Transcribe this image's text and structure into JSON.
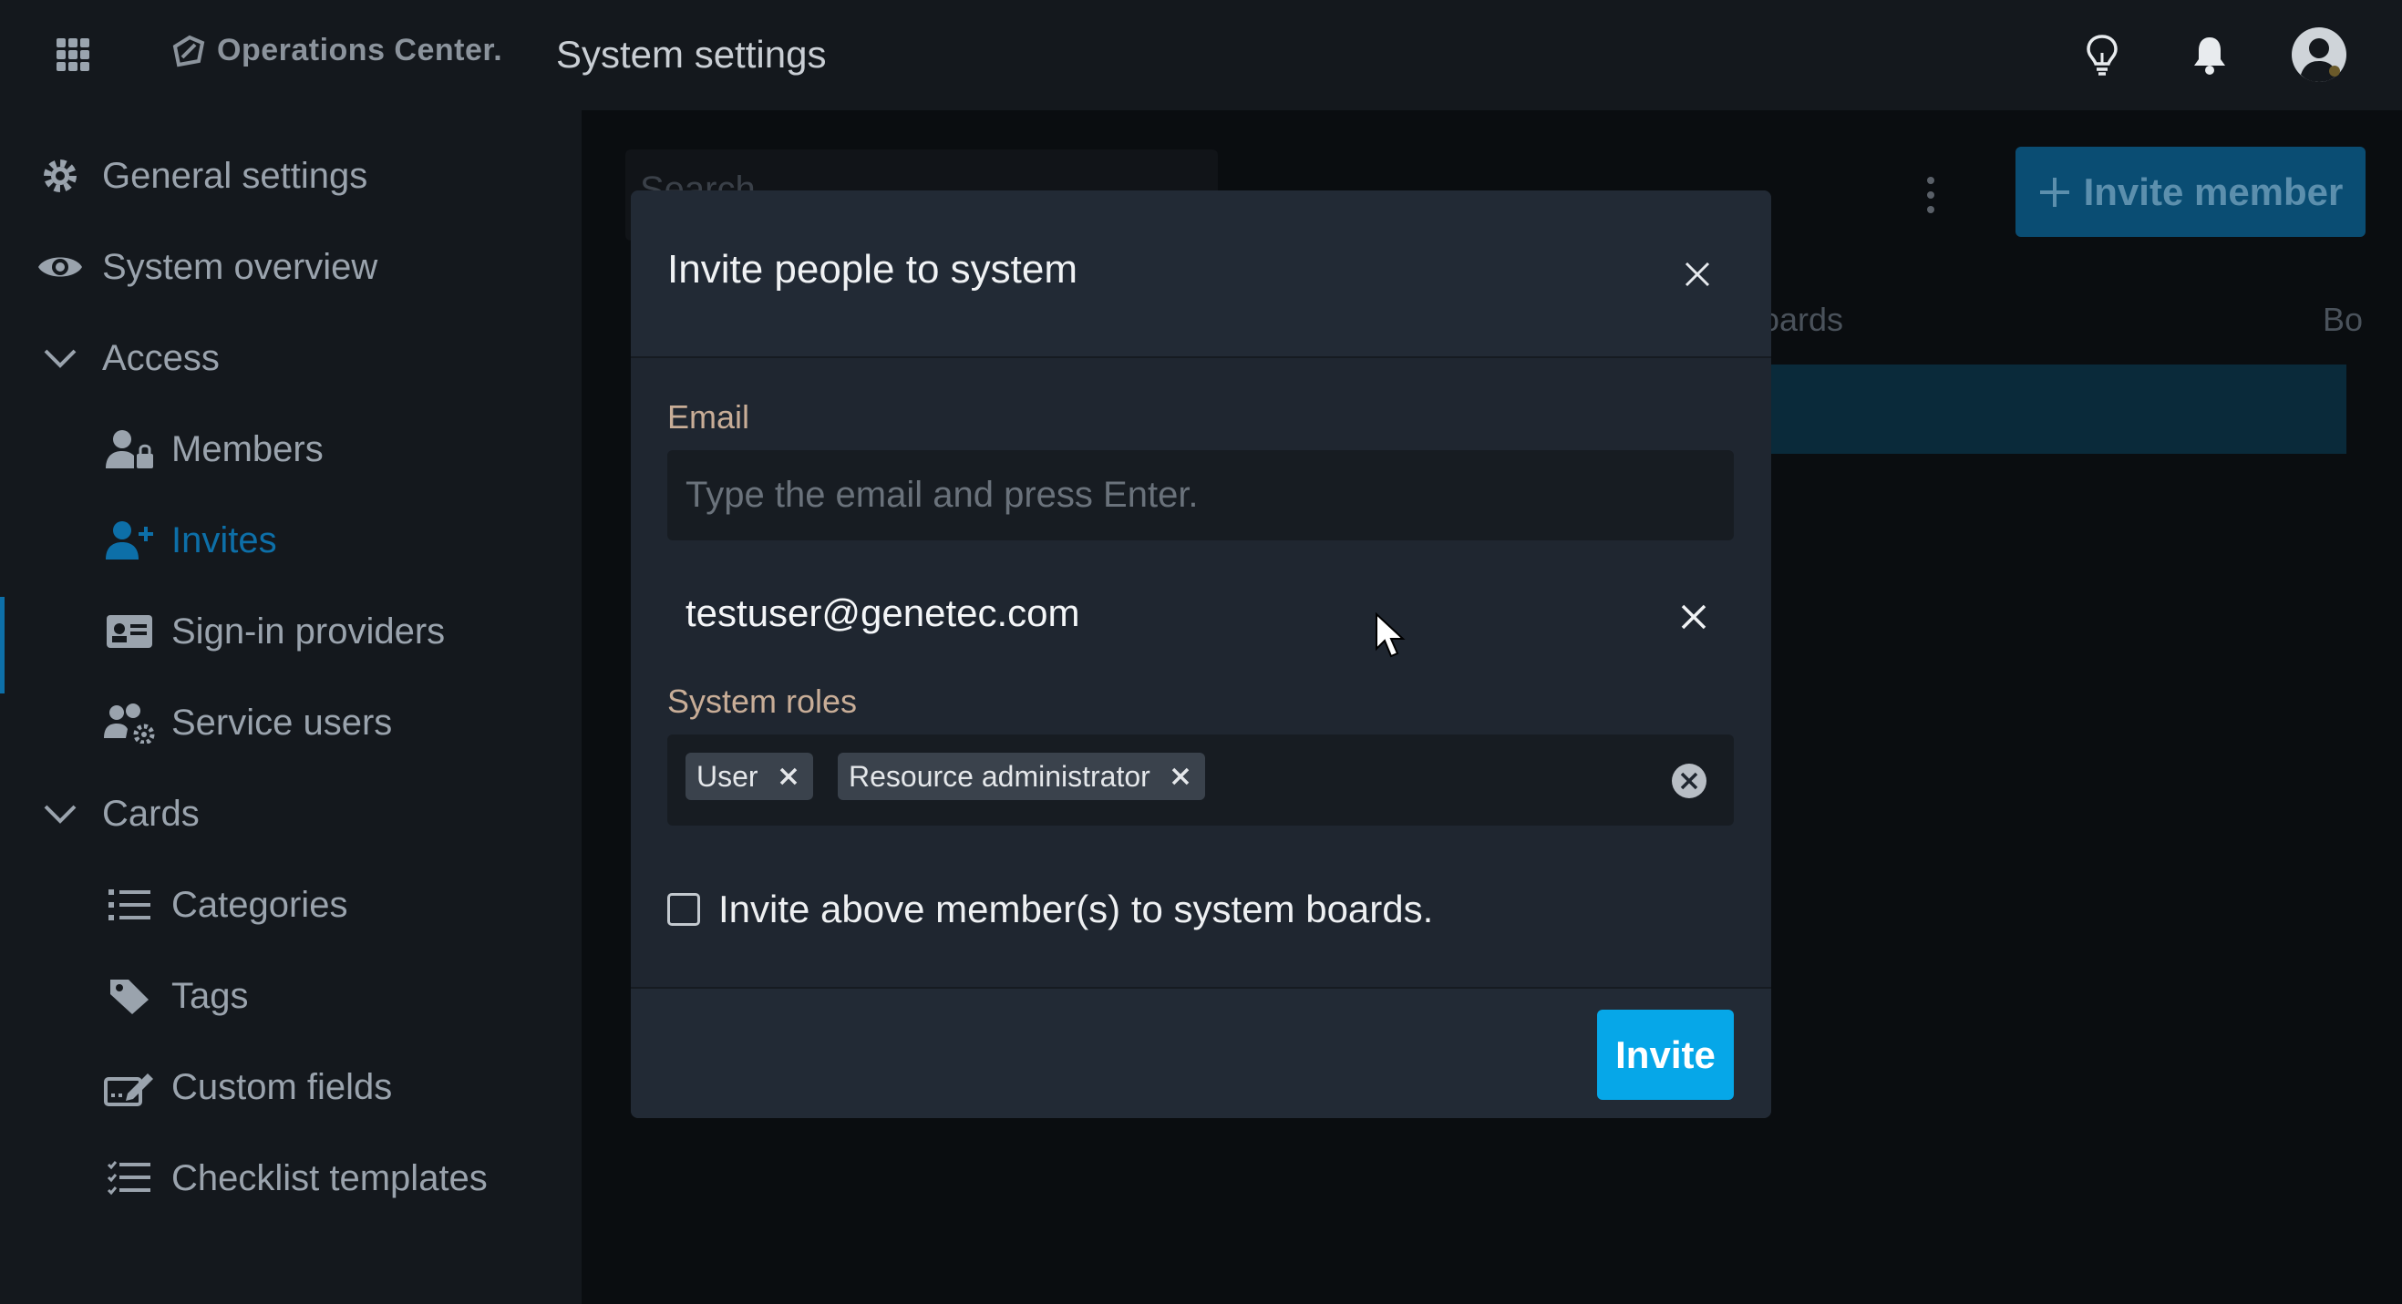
{
  "topbar": {
    "brand": "Operations Center.",
    "page_title": "System settings",
    "icons": [
      "apps-grid-icon",
      "lightbulb-icon",
      "bell-icon",
      "user-avatar-icon"
    ]
  },
  "sidebar": {
    "items": [
      {
        "label": "General settings",
        "icon": "gear-icon"
      },
      {
        "label": "System overview",
        "icon": "eye-icon"
      },
      {
        "label": "Access",
        "icon": "chevron-down-icon"
      },
      {
        "label": "Members",
        "icon": "user-lock-icon"
      },
      {
        "label": "Invites",
        "icon": "user-plus-icon",
        "active": true
      },
      {
        "label": "Sign-in providers",
        "icon": "id-card-icon"
      },
      {
        "label": "Service users",
        "icon": "users-gear-icon"
      },
      {
        "label": "Cards",
        "icon": "chevron-down-icon"
      },
      {
        "label": "Categories",
        "icon": "list-icon"
      },
      {
        "label": "Tags",
        "icon": "tag-icon"
      },
      {
        "label": "Custom fields",
        "icon": "form-edit-icon"
      },
      {
        "label": "Checklist templates",
        "icon": "checklist-icon"
      }
    ]
  },
  "background": {
    "search_placeholder": "Search",
    "invite_member_label": "Invite member",
    "column_boards": "oards",
    "column_b": "Bo"
  },
  "modal": {
    "title": "Invite people to system",
    "email_label": "Email",
    "email_placeholder": "Type the email and press Enter.",
    "email_entries": [
      "testuser@genetec.com"
    ],
    "roles_label": "System roles",
    "roles": [
      "User",
      "Resource administrator"
    ],
    "checkbox_label": "Invite above member(s) to system boards.",
    "checkbox_checked": false,
    "invite_button": "Invite"
  },
  "colors": {
    "accent": "#06a7e8",
    "active_nav": "#0d6fa8",
    "label_tan": "#c8ad97"
  }
}
